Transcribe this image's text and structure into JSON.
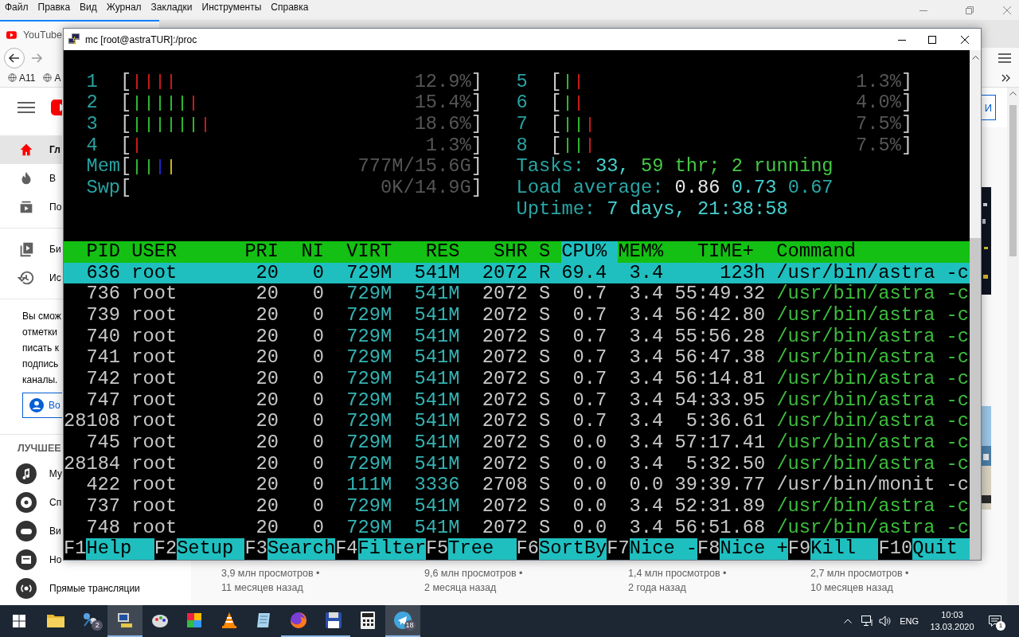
{
  "browser": {
    "menu": [
      "Файл",
      "Правка",
      "Вид",
      "Журнал",
      "Закладки",
      "Инструменты",
      "Справка"
    ],
    "tab": {
      "title": "YouTube",
      "selected": true
    },
    "bookmarks": [
      "A11",
      "A"
    ],
    "signin_button": "И",
    "sidebar": {
      "main": [
        {
          "label": "Гл",
          "selected": true,
          "kind": "home"
        },
        {
          "label": "В",
          "selected": false,
          "kind": "flame"
        },
        {
          "label": "По",
          "selected": false,
          "kind": "subs"
        }
      ],
      "library": [
        {
          "label": "Би",
          "selected": false,
          "kind": "library"
        },
        {
          "label": "Ис",
          "selected": false,
          "kind": "history"
        }
      ],
      "prompt": "Вы смож\nотметки\nписать к\nподпись\nканалы.",
      "login": "Во",
      "heading": "ЛУЧШЕЕ",
      "best": [
        {
          "label": "Му",
          "kind": "music"
        },
        {
          "label": "Сп",
          "kind": "sport"
        },
        {
          "label": "Ви",
          "kind": "games"
        },
        {
          "label": "Но",
          "kind": "news"
        },
        {
          "label": "Прямые трансляции",
          "kind": "live"
        }
      ]
    },
    "videos": [
      {
        "views": "3,9 млн просмотров •",
        "age": "11 месяцев назад"
      },
      {
        "views": "9,6 млн просмотров •",
        "age": "2 месяца назад"
      },
      {
        "views": "1,4 млн просмотров •",
        "age": "2 года назад"
      },
      {
        "views": "2,7 млн просмотров •",
        "age": "10 месяцев назад"
      }
    ]
  },
  "terminal": {
    "title": "mc [root@astraTUR]:/proc",
    "meters_left": [
      {
        "label": "1",
        "open": "[",
        "bars": [
          {
            "color": "#c41a1a"
          },
          {
            "color": "#c41a1a"
          },
          {
            "color": "#c41a1a"
          },
          {
            "color": "#c41a1a"
          }
        ],
        "reading": "12.9%",
        "close": "]"
      },
      {
        "label": "2",
        "open": "[",
        "bars": [
          {
            "color": "#2fb52f"
          },
          {
            "color": "#2fb52f"
          },
          {
            "color": "#2fb52f"
          },
          {
            "color": "#2fb52f"
          },
          {
            "color": "#2fb52f"
          },
          {
            "color": "#c41a1a"
          }
        ],
        "reading": "15.4%",
        "close": "]"
      },
      {
        "label": "3",
        "open": "[",
        "bars": [
          {
            "color": "#2fb52f"
          },
          {
            "color": "#2fb52f"
          },
          {
            "color": "#2fb52f"
          },
          {
            "color": "#2fb52f"
          },
          {
            "color": "#2fb52f"
          },
          {
            "color": "#2fb52f"
          },
          {
            "color": "#c41a1a"
          }
        ],
        "reading": "18.6%",
        "close": "]"
      },
      {
        "label": "4",
        "open": "[",
        "bars": [
          {
            "color": "#c41a1a"
          }
        ],
        "reading": "1.3%",
        "close": "]"
      },
      {
        "label": "Mem",
        "open": "[",
        "bars": [
          {
            "color": "#2fb52f"
          },
          {
            "color": "#2fb52f"
          },
          {
            "color": "#2222c8"
          },
          {
            "color": "#c8b41a"
          }
        ],
        "reading": "777M/15.6G",
        "close": "]"
      },
      {
        "label": "Swp",
        "open": "[",
        "reading": "0K/14.9G",
        "close": "]"
      }
    ],
    "meters_right": [
      {
        "label": "5",
        "open": "[",
        "bars": [
          {
            "color": "#2fb52f"
          },
          {
            "color": "#c41a1a"
          }
        ],
        "reading": "1.3%",
        "close": "]"
      },
      {
        "label": "6",
        "open": "[",
        "bars": [
          {
            "color": "#2fb52f"
          },
          {
            "color": "#c41a1a"
          }
        ],
        "reading": "4.0%",
        "close": "]"
      },
      {
        "label": "7",
        "open": "[",
        "bars": [
          {
            "color": "#2fb52f"
          },
          {
            "color": "#2fb52f"
          },
          {
            "color": "#c41a1a"
          }
        ],
        "reading": "7.5%",
        "close": "]"
      },
      {
        "label": "8",
        "open": "[",
        "bars": [
          {
            "color": "#2fb52f"
          },
          {
            "color": "#2fb52f"
          },
          {
            "color": "#c41a1a"
          }
        ],
        "reading": "7.5%",
        "close": "]"
      }
    ],
    "stats": [
      {
        "segments": [
          {
            "text": "Tasks:",
            "color": "#2aa5a5"
          },
          {
            "text": "33,",
            "color": "#45d0d0"
          },
          {
            "text": "59",
            "color": "#45c845"
          },
          {
            "text": "thr;",
            "color": "#45c845"
          },
          {
            "text": "2",
            "color": "#45c845"
          },
          {
            "text": "running",
            "color": "#45c845"
          }
        ]
      },
      {
        "segments": [
          {
            "text": "Load average:",
            "color": "#2aa5a5"
          },
          {
            "text": "0.86",
            "color": "#e6e6e6"
          },
          {
            "text": "0.73",
            "color": "#45d0d0"
          },
          {
            "text": "0.67",
            "color": "#2aa5a5"
          }
        ]
      },
      {
        "segments": [
          {
            "text": "Uptime:",
            "color": "#2aa5a5"
          },
          {
            "text": "7 days, 21:38:58",
            "color": "#45d0d0"
          }
        ]
      }
    ],
    "columns": [
      {
        "label": "PID",
        "sorted": false
      },
      {
        "label": "USER",
        "sorted": false
      },
      {
        "label": "PRI",
        "sorted": false
      },
      {
        "label": "NI",
        "sorted": false
      },
      {
        "label": "VIRT",
        "sorted": false
      },
      {
        "label": "RES",
        "sorted": false
      },
      {
        "label": "SHR",
        "sorted": false
      },
      {
        "label": "S",
        "sorted": false
      },
      {
        "label": "CPU%",
        "sorted": true
      },
      {
        "label": "MEM%",
        "sorted": false
      },
      {
        "label": "TIME+",
        "sorted": false
      },
      {
        "label": "Command",
        "sorted": false
      }
    ],
    "processes": [
      {
        "pid": "636",
        "user": "root",
        "pri": "20",
        "ni": "0",
        "virt": "729M",
        "res": "541M",
        "shr": "2072",
        "state": "R",
        "cpu": "69.4",
        "mem": "3.4",
        "time": "123h",
        "command": "/usr/bin/astra -c",
        "selected": true,
        "thread": false
      },
      {
        "pid": "736",
        "user": "root",
        "pri": "20",
        "ni": "0",
        "virt": "729M",
        "res": "541M",
        "shr": "2072",
        "state": "S",
        "cpu": "0.7",
        "mem": "3.4",
        "time": "55:49.32",
        "command": "/usr/bin/astra -c",
        "selected": false,
        "thread": true
      },
      {
        "pid": "739",
        "user": "root",
        "pri": "20",
        "ni": "0",
        "virt": "729M",
        "res": "541M",
        "shr": "2072",
        "state": "S",
        "cpu": "0.7",
        "mem": "3.4",
        "time": "56:42.80",
        "command": "/usr/bin/astra -c",
        "selected": false,
        "thread": true
      },
      {
        "pid": "740",
        "user": "root",
        "pri": "20",
        "ni": "0",
        "virt": "729M",
        "res": "541M",
        "shr": "2072",
        "state": "S",
        "cpu": "0.7",
        "mem": "3.4",
        "time": "55:56.28",
        "command": "/usr/bin/astra -c",
        "selected": false,
        "thread": true
      },
      {
        "pid": "741",
        "user": "root",
        "pri": "20",
        "ni": "0",
        "virt": "729M",
        "res": "541M",
        "shr": "2072",
        "state": "S",
        "cpu": "0.7",
        "mem": "3.4",
        "time": "56:47.38",
        "command": "/usr/bin/astra -c",
        "selected": false,
        "thread": true
      },
      {
        "pid": "742",
        "user": "root",
        "pri": "20",
        "ni": "0",
        "virt": "729M",
        "res": "541M",
        "shr": "2072",
        "state": "S",
        "cpu": "0.7",
        "mem": "3.4",
        "time": "56:14.81",
        "command": "/usr/bin/astra -c",
        "selected": false,
        "thread": true
      },
      {
        "pid": "747",
        "user": "root",
        "pri": "20",
        "ni": "0",
        "virt": "729M",
        "res": "541M",
        "shr": "2072",
        "state": "S",
        "cpu": "0.7",
        "mem": "3.4",
        "time": "54:33.95",
        "command": "/usr/bin/astra -c",
        "selected": false,
        "thread": true
      },
      {
        "pid": "28108",
        "user": "root",
        "pri": "20",
        "ni": "0",
        "virt": "729M",
        "res": "541M",
        "shr": "2072",
        "state": "S",
        "cpu": "0.7",
        "mem": "3.4",
        "time": "5:36.61",
        "command": "/usr/bin/astra -c",
        "selected": false,
        "thread": true
      },
      {
        "pid": "745",
        "user": "root",
        "pri": "20",
        "ni": "0",
        "virt": "729M",
        "res": "541M",
        "shr": "2072",
        "state": "S",
        "cpu": "0.0",
        "mem": "3.4",
        "time": "57:17.41",
        "command": "/usr/bin/astra -c",
        "selected": false,
        "thread": true
      },
      {
        "pid": "28184",
        "user": "root",
        "pri": "20",
        "ni": "0",
        "virt": "729M",
        "res": "541M",
        "shr": "2072",
        "state": "S",
        "cpu": "0.0",
        "mem": "3.4",
        "time": "5:32.50",
        "command": "/usr/bin/astra -c",
        "selected": false,
        "thread": true
      },
      {
        "pid": "422",
        "user": "root",
        "pri": "20",
        "ni": "0",
        "virt": "111M",
        "res": "3336",
        "shr": "2708",
        "state": "S",
        "cpu": "0.0",
        "mem": "0.0",
        "time": "39:39.77",
        "command": "/usr/bin/monit -c",
        "selected": false,
        "thread": false
      },
      {
        "pid": "737",
        "user": "root",
        "pri": "20",
        "ni": "0",
        "virt": "729M",
        "res": "541M",
        "shr": "2072",
        "state": "S",
        "cpu": "0.0",
        "mem": "3.4",
        "time": "52:31.89",
        "command": "/usr/bin/astra -c",
        "selected": false,
        "thread": true
      },
      {
        "pid": "748",
        "user": "root",
        "pri": "20",
        "ni": "0",
        "virt": "729M",
        "res": "541M",
        "shr": "2072",
        "state": "S",
        "cpu": "0.0",
        "mem": "3.4",
        "time": "56:51.68",
        "command": "/usr/bin/astra -c",
        "selected": false,
        "thread": true
      }
    ],
    "keys": [
      {
        "key": "F1",
        "label": "Help"
      },
      {
        "key": "F2",
        "label": "Setup"
      },
      {
        "key": "F3",
        "label": "Search"
      },
      {
        "key": "F4",
        "label": "Filter"
      },
      {
        "key": "F5",
        "label": "Tree"
      },
      {
        "key": "F6",
        "label": "SortBy"
      },
      {
        "key": "F7",
        "label": "Nice -"
      },
      {
        "key": "F8",
        "label": "Nice +"
      },
      {
        "key": "F9",
        "label": "Kill"
      },
      {
        "key": "F10",
        "label": "Quit"
      }
    ]
  },
  "taskbar": {
    "apps": [
      {
        "kind": "folder",
        "running": false,
        "selected": false
      },
      {
        "kind": "network",
        "running": false,
        "selected": false,
        "badge": "2"
      },
      {
        "kind": "computer",
        "running": true,
        "selected": true
      },
      {
        "kind": "palette",
        "running": false,
        "selected": false
      },
      {
        "kind": "tiles",
        "running": false,
        "selected": false
      },
      {
        "kind": "cone",
        "running": false,
        "selected": false
      },
      {
        "kind": "notepad",
        "running": false,
        "selected": false
      },
      {
        "kind": "browser",
        "running": true,
        "selected": false
      },
      {
        "kind": "floppy",
        "running": true,
        "selected": false
      },
      {
        "kind": "calculator",
        "running": false,
        "selected": false
      },
      {
        "kind": "plane",
        "running": true,
        "selected": true,
        "badge": "18"
      }
    ],
    "language": "ENG",
    "time": "10:03",
    "date": "13.03.2020",
    "notifications": "1"
  }
}
